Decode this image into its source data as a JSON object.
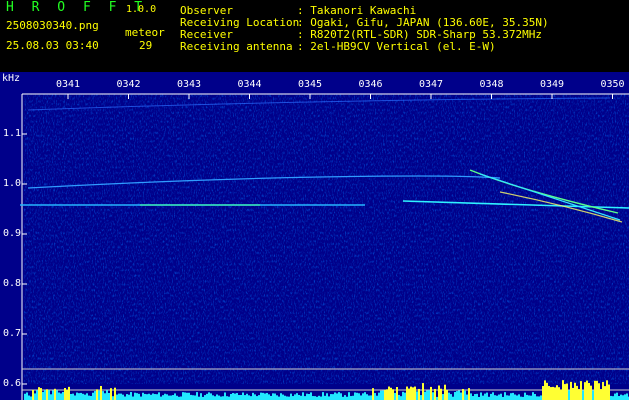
{
  "app": {
    "name": "H R O F F T",
    "version": "1.0.0"
  },
  "file": {
    "name": "2508030340.png",
    "datetime": "25.08.03 03:40"
  },
  "meteor": {
    "label": "meteor",
    "count": "29"
  },
  "info": [
    {
      "label": "Observer",
      "value": ": Takanori Kawachi"
    },
    {
      "label": "Receiving Location",
      "value": ": Ogaki, Gifu, JAPAN (136.60E, 35.35N)"
    },
    {
      "label": "Receiver",
      "value": ": R820T2(RTL-SDR) SDR-Sharp 53.372MHz"
    },
    {
      "label": "Receiving antenna",
      "value": ": 2el-HB9CV Vertical (el. E-W)"
    }
  ],
  "axis": {
    "unit": "kHz",
    "time_ticks": [
      "0341",
      "0342",
      "0343",
      "0344",
      "0345",
      "0346",
      "0347",
      "0348",
      "0349",
      "0350"
    ],
    "freq_ticks": [
      "1.1",
      "1.0",
      "0.9",
      "0.8",
      "0.7",
      "0.6"
    ]
  },
  "colors": {
    "background": "#00008a",
    "logo": "#22ff22",
    "accent": "#ffff00",
    "signal": "#00ffff",
    "meteor": "#ffff66"
  }
}
